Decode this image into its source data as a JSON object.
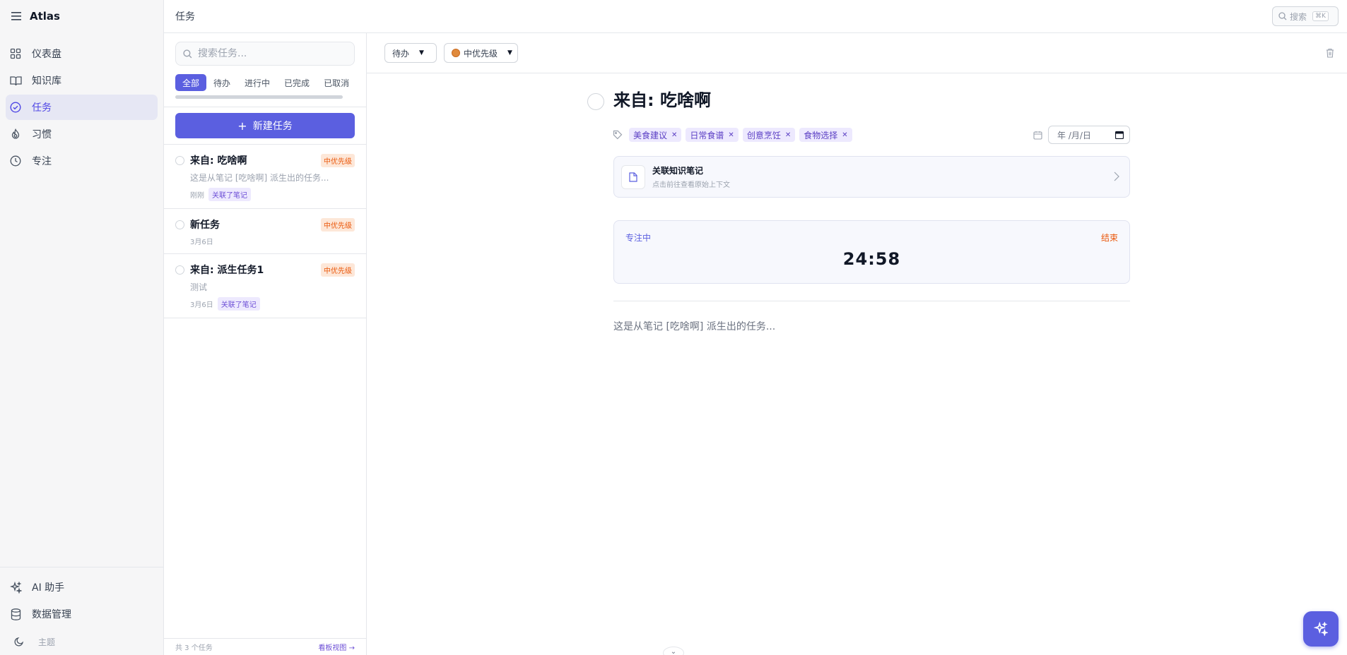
{
  "app": {
    "title": "Atlas"
  },
  "sidebar": {
    "items": [
      {
        "label": "仪表盘",
        "icon": "grid-icon"
      },
      {
        "label": "知识库",
        "icon": "book-icon"
      },
      {
        "label": "任务",
        "icon": "check-circle-icon",
        "active": true
      },
      {
        "label": "习惯",
        "icon": "flame-icon"
      },
      {
        "label": "专注",
        "icon": "clock-icon"
      }
    ],
    "bottom_items": [
      {
        "label": "AI 助手",
        "icon": "sparkles-icon"
      },
      {
        "label": "数据管理",
        "icon": "database-icon"
      }
    ],
    "theme_label": "主题"
  },
  "topbar": {
    "breadcrumb": "任务",
    "search_label": "搜索",
    "search_shortcut": "⌘K"
  },
  "task_list": {
    "search_placeholder": "搜索任务...",
    "filters": [
      "全部",
      "待办",
      "进行中",
      "已完成",
      "已取消"
    ],
    "active_filter": "全部",
    "new_task_label": "新建任务",
    "tasks": [
      {
        "title": "来自: 吃啥啊",
        "priority": "中优先级",
        "description": "这是从笔记 [吃啥啊] 派生出的任务...",
        "date": "刚刚",
        "linked_badge": "关联了笔记"
      },
      {
        "title": "新任务",
        "priority": "中优先级",
        "description": "",
        "date": "3月6日",
        "linked_badge": ""
      },
      {
        "title": "来自: 派生任务1",
        "priority": "中优先级",
        "description": "测试",
        "date": "3月6日",
        "linked_badge": "关联了笔记"
      }
    ],
    "footer_count": "共 3 个任务",
    "footer_board": "看板视图 →"
  },
  "detail": {
    "status_select": "待办",
    "priority_select": "中优先级",
    "title": "来自: 吃啥啊",
    "tags": [
      "美食建议",
      "日常食谱",
      "创意烹饪",
      "食物选择"
    ],
    "date_placeholder": "年 /月/日",
    "linked_note": {
      "title": "关联知识笔记",
      "subtitle": "点击前往查看原始上下文"
    },
    "focus": {
      "label": "专注中",
      "end_label": "结束",
      "time": "24:58"
    },
    "body": "这是从笔记 [吃啥啊] 派生出的任务..."
  },
  "colors": {
    "accent": "#5b5fe0",
    "priority_orange": "#ea580c",
    "tag_purple": "#5b3fc4"
  }
}
